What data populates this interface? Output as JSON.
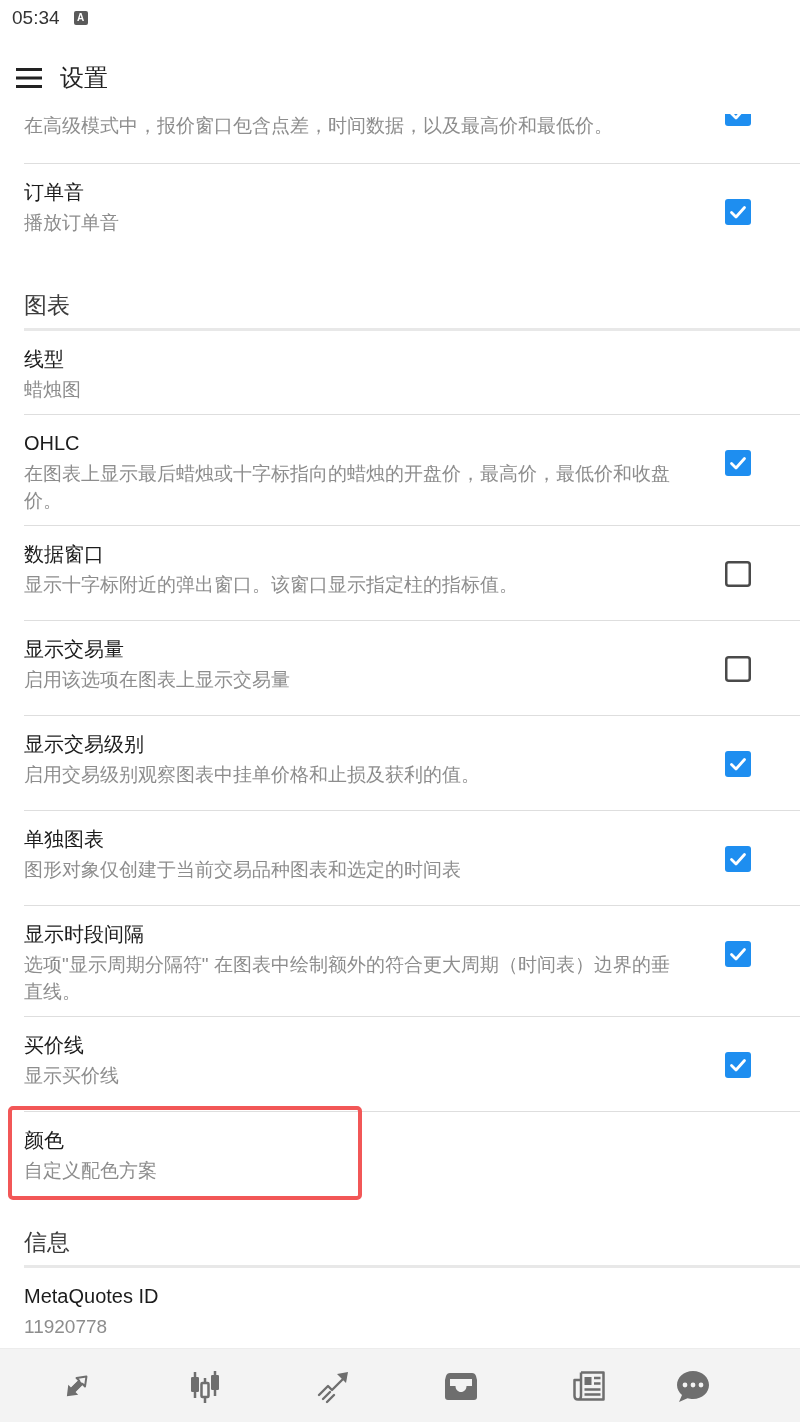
{
  "status_bar": {
    "time": "05:34",
    "notification": "A"
  },
  "header": {
    "title": "设置"
  },
  "sections": [
    {
      "items": [
        {
          "kind": "checkbox",
          "subtitle": "在高级模式中，报价窗口包含点差，时间数据，以及最高价和最低价。",
          "checked": true,
          "highlighted": false
        },
        {
          "kind": "checkbox",
          "title": "订单音",
          "subtitle": "播放订单音",
          "checked": true,
          "highlighted": false
        }
      ]
    },
    {
      "title": "图表",
      "items": [
        {
          "kind": "text",
          "title": "线型",
          "subtitle": "蜡烛图",
          "highlighted": false
        },
        {
          "kind": "checkbox",
          "title": "OHLC",
          "subtitle": "在图表上显示最后蜡烛或十字标指向的蜡烛的开盘价，最高价，最低价和收盘价。",
          "checked": true,
          "highlighted": false
        },
        {
          "kind": "checkbox",
          "title": "数据窗口",
          "subtitle": "显示十字标附近的弹出窗口。该窗口显示指定柱的指标值。",
          "checked": false,
          "highlighted": false
        },
        {
          "kind": "checkbox",
          "title": "显示交易量",
          "subtitle": "启用该选项在图表上显示交易量",
          "checked": false,
          "highlighted": false
        },
        {
          "kind": "checkbox",
          "title": "显示交易级别",
          "subtitle": "启用交易级别观察图表中挂单价格和止损及获利的值。",
          "checked": true,
          "highlighted": false
        },
        {
          "kind": "checkbox",
          "title": "单独图表",
          "subtitle": "图形对象仅创建于当前交易品种图表和选定的时间表",
          "checked": true,
          "highlighted": false
        },
        {
          "kind": "checkbox",
          "title": "显示时段间隔",
          "subtitle": "选项\"显示周期分隔符\" 在图表中绘制额外的符合更大周期（时间表）边界的垂直线。",
          "checked": true,
          "highlighted": false
        },
        {
          "kind": "checkbox",
          "title": "买价线",
          "subtitle": "显示买价线",
          "checked": true,
          "highlighted": false
        },
        {
          "kind": "text",
          "title": "颜色",
          "subtitle": "自定义配色方案",
          "highlighted": true
        }
      ]
    },
    {
      "title": "信息",
      "items": [
        {
          "kind": "text",
          "title": "MetaQuotes ID",
          "subtitle": "11920778",
          "highlighted": false
        }
      ]
    }
  ]
}
